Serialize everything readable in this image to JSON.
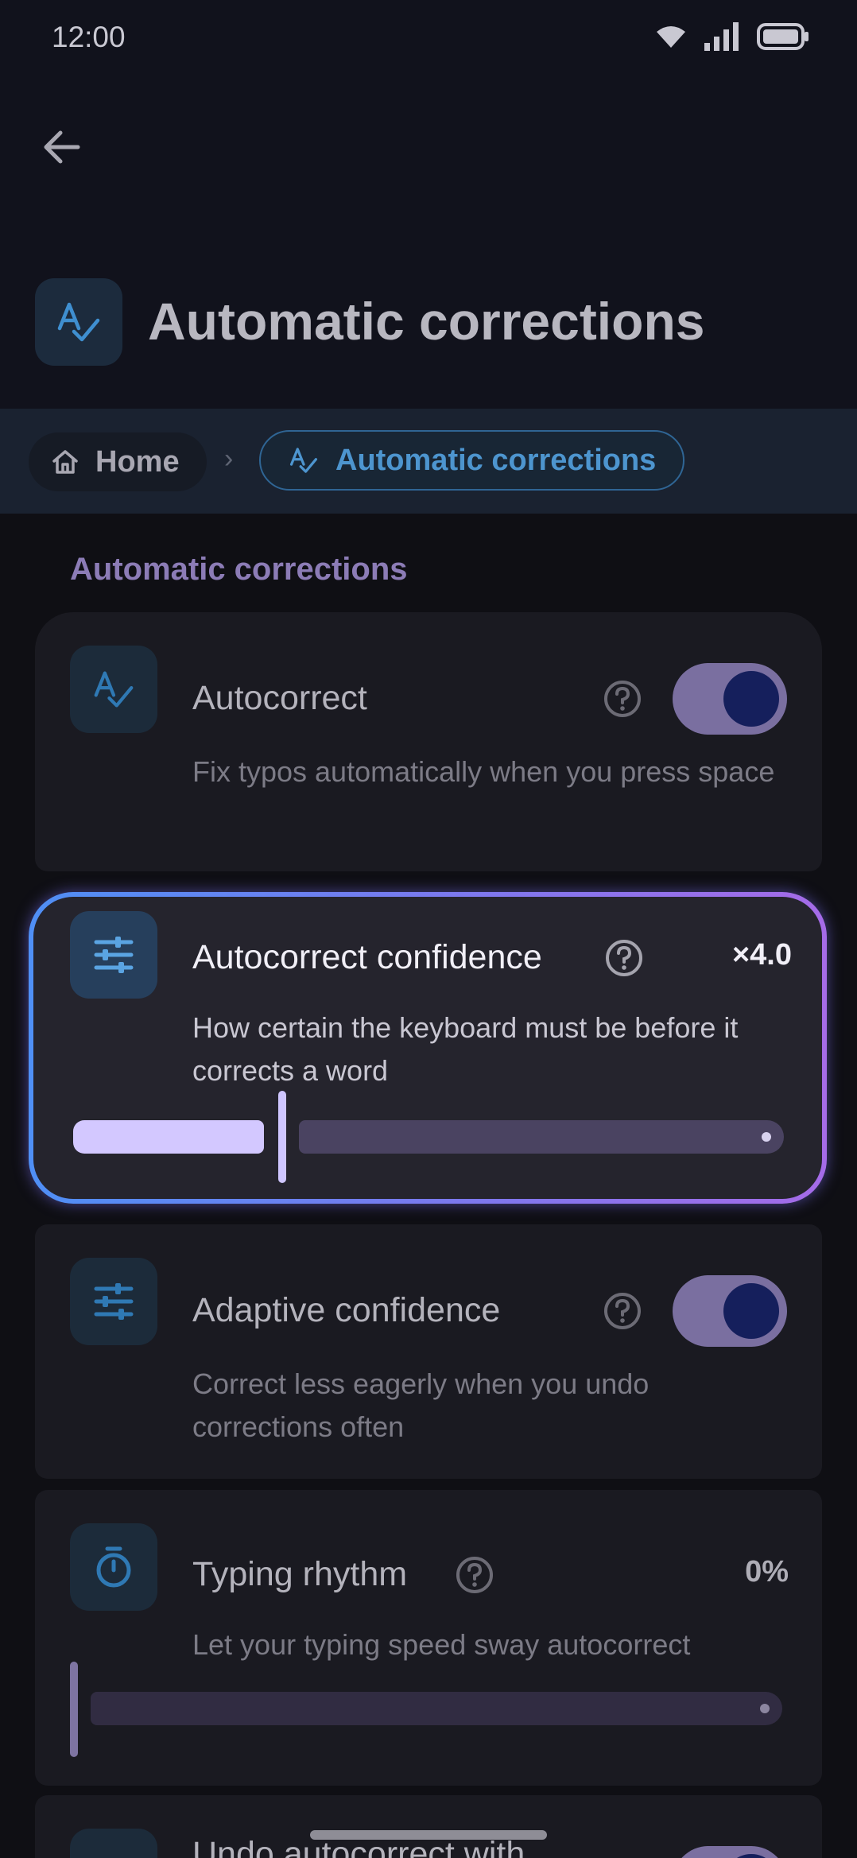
{
  "status": {
    "time": "12:00"
  },
  "app": {
    "title": "Automatic corrections"
  },
  "breadcrumb": {
    "home": "Home",
    "current": "Automatic corrections"
  },
  "section": {
    "header": "Automatic corrections"
  },
  "items": [
    {
      "title": "Autocorrect",
      "description": "Fix typos automatically when you press space",
      "enabled": true
    },
    {
      "title": "Autocorrect confidence",
      "description": "How certain the keyboard must be before it corrects a word",
      "value": "×4.0",
      "slider_fraction": 0.3
    },
    {
      "title": "Adaptive confidence",
      "description": "Correct less eagerly when you undo corrections often",
      "enabled": true
    },
    {
      "title": "Typing rhythm",
      "description": "Let your typing speed sway autocorrect",
      "value": "0%",
      "slider_fraction": 0.0
    },
    {
      "title": "Undo autocorrect with",
      "enabled": true
    }
  ],
  "colors": {
    "accent": "#4d95cf",
    "toggle_track": "#7a6fa0",
    "toggle_knob": "#151f5c",
    "slider_fill": "#d3c8ff",
    "focus_ring_start": "#4f8ff5",
    "focus_ring_end": "#a56be8"
  },
  "icons": {
    "back": "arrow-left-icon",
    "spellcheck": "spellcheck-icon",
    "tune": "tune-icon",
    "timer": "timer-icon",
    "help": "help-circle-icon",
    "home": "home-icon",
    "wifi": "wifi-icon",
    "signal": "signal-icon",
    "battery": "battery-icon"
  }
}
